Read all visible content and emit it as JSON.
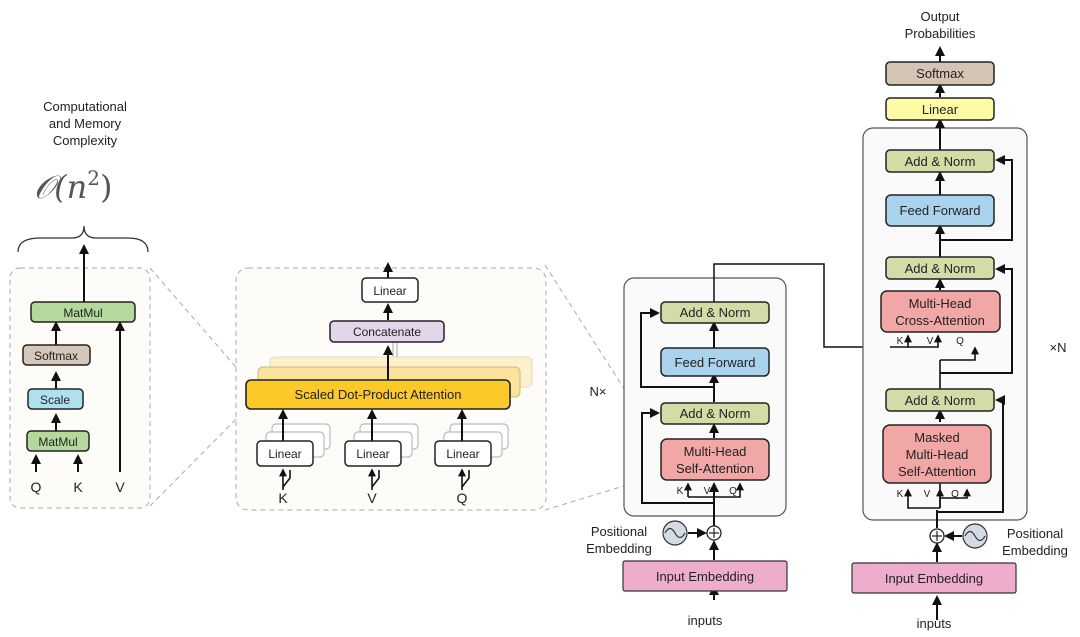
{
  "complexity": {
    "title_lines": [
      "Computational",
      "and Memory",
      "Complexity"
    ],
    "formula_base": "𝒪(n",
    "formula_exp": "2",
    "formula_close": ")"
  },
  "sdpa": {
    "matmul_top": "MatMul",
    "softmax": "Softmax",
    "scale": "Scale",
    "matmul_bottom": "MatMul",
    "inputs": [
      "Q",
      "K",
      "V"
    ]
  },
  "mha": {
    "linear_out": "Linear",
    "concatenate": "Concatenate",
    "attention": "Scaled Dot-Product Attention",
    "linears": [
      "Linear",
      "Linear",
      "Linear"
    ],
    "inputs": [
      "K",
      "V",
      "Q"
    ]
  },
  "encoder": {
    "repeat_label": "N×",
    "add_norm_top": "Add & Norm",
    "feed_forward": "Feed Forward",
    "add_norm_bottom": "Add & Norm",
    "attention_lines": [
      "Multi-Head",
      "Self-Attention"
    ],
    "kvq": [
      "K",
      "V",
      "Q"
    ],
    "positional_lines": [
      "Positional",
      "Embedding"
    ],
    "input_embedding": "Input Embedding",
    "inputs_label": "inputs"
  },
  "decoder": {
    "output_lines": [
      "Output",
      "Probabilities"
    ],
    "softmax": "Softmax",
    "linear": "Linear",
    "repeat_label": "×N",
    "add_norm_top": "Add & Norm",
    "feed_forward": "Feed Forward",
    "add_norm_mid": "Add & Norm",
    "cross_attention_lines": [
      "Multi-Head",
      "Cross-Attention"
    ],
    "cross_kvq": [
      "K",
      "V",
      "Q"
    ],
    "add_norm_bottom": "Add & Norm",
    "masked_attention_lines": [
      "Masked",
      "Multi-Head",
      "Self-Attention"
    ],
    "kvq": [
      "K",
      "V",
      "Q"
    ],
    "positional_lines": [
      "Positional",
      "Embedding"
    ],
    "input_embedding": "Input Embedding",
    "inputs_label": "inputs"
  },
  "colors": {
    "matmul": "#b5d99c",
    "softmax": "#d6c8b8",
    "scale": "#aee0f0",
    "linear_white": "#ffffff",
    "concatenate": "#e3d5ea",
    "attention_yellow": "#fcc929",
    "add_norm": "#d2dca6",
    "feed_forward": "#a9d2ec",
    "attention_red": "#f2a7a7",
    "input_embedding": "#efadcd",
    "linear_yellow": "#fdfca4",
    "softmax_out": "#d4c4b3",
    "pos_embedding": "#d4dbe5",
    "panel_fill": "#fdfcf8",
    "block_fill": "#fafafa"
  }
}
